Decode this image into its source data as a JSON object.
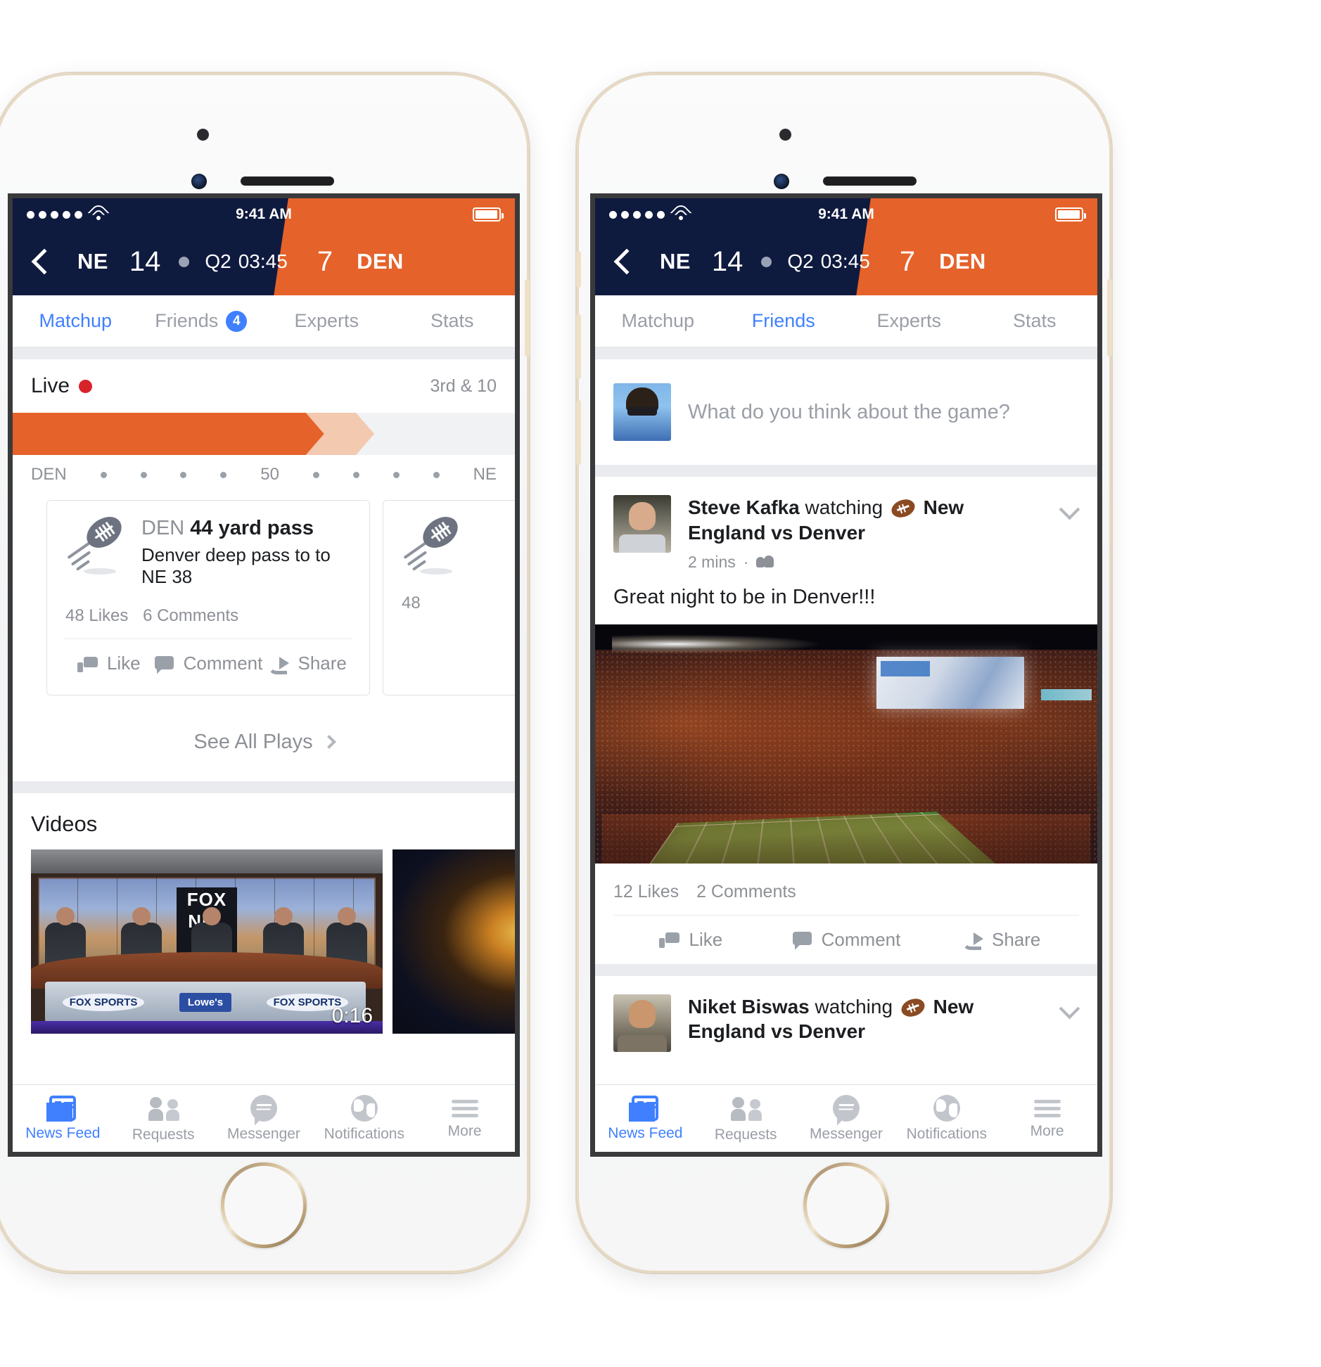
{
  "status_bar": {
    "time": "9:41 AM",
    "signal_icon": "signal-dots-icon",
    "wifi_icon": "wifi-icon",
    "battery_icon": "battery-icon"
  },
  "scoreboard": {
    "back_icon": "back-chevron-icon",
    "away_team": "NE",
    "away_score": "14",
    "possession_icon": "possession-dot-icon",
    "period": "Q2",
    "clock": "03:45",
    "home_score": "7",
    "home_team": "DEN",
    "navy_color": "#0f1a3f",
    "orange_color": "#e5622a"
  },
  "tabs_left": [
    {
      "label": "Matchup",
      "active": true,
      "badge": null
    },
    {
      "label": "Friends",
      "active": false,
      "badge": "4"
    },
    {
      "label": "Experts",
      "active": false,
      "badge": null
    },
    {
      "label": "Stats",
      "active": false,
      "badge": null
    }
  ],
  "tabs_right": [
    {
      "label": "Matchup",
      "active": false,
      "badge": null
    },
    {
      "label": "Friends",
      "active": true,
      "badge": null
    },
    {
      "label": "Experts",
      "active": false,
      "badge": null
    },
    {
      "label": "Stats",
      "active": false,
      "badge": null
    }
  ],
  "live": {
    "label": "Live",
    "live_dot_color": "#d8232a",
    "down_distance": "3rd & 10",
    "progress_percent": 62,
    "ghost_percent": 72,
    "field_left_label": "DEN",
    "field_mid_label": "50",
    "field_right_label": "NE"
  },
  "play_card": {
    "icon": "flying-football-icon",
    "team": "DEN",
    "headline": "44 yard pass",
    "description": "Denver deep pass to to NE 38",
    "likes": "48 Likes",
    "comments": "6 Comments",
    "like_label": "Like",
    "comment_label": "Comment",
    "share_label": "Share",
    "peek_likes": "48"
  },
  "see_all_plays": {
    "label": "See All Plays",
    "chevron_icon": "chevron-right-icon"
  },
  "videos_section": {
    "title": "Videos",
    "items": [
      {
        "name": "fox-nfl-studio-thumbnail",
        "duration": "0:16",
        "logo": "FOX",
        "logo_line2": "NFL",
        "sponsor": "Lowe's",
        "brand": "FOX SPORTS"
      },
      {
        "name": "dark-video-thumbnail",
        "duration": ""
      }
    ]
  },
  "composer": {
    "placeholder": "What do you think about the game?",
    "avatar": "user-avatar"
  },
  "posts": [
    {
      "author": "Steve Kafka",
      "action": "watching",
      "football_icon": "football-emoji-icon",
      "event": "New England vs Denver",
      "time": "2 mins",
      "audience_icon": "friends-audience-icon",
      "caret_icon": "chevron-down-icon",
      "text": "Great night to be in Denver!!!",
      "photo": "denver-stadium-night-photo",
      "likes": "12 Likes",
      "comments": "2 Comments",
      "like_label": "Like",
      "comment_label": "Comment",
      "share_label": "Share"
    },
    {
      "author": "Niket Biswas",
      "action": "watching",
      "football_icon": "football-emoji-icon",
      "event": "New England vs Denver",
      "caret_icon": "chevron-down-icon"
    }
  ],
  "tab_bar": [
    {
      "label": "News Feed",
      "icon": "news-feed-icon",
      "active": true
    },
    {
      "label": "Requests",
      "icon": "friend-requests-icon",
      "active": false
    },
    {
      "label": "Messenger",
      "icon": "messenger-icon",
      "active": false
    },
    {
      "label": "Notifications",
      "icon": "globe-icon",
      "active": false
    },
    {
      "label": "More",
      "icon": "hamburger-icon",
      "active": false
    }
  ]
}
